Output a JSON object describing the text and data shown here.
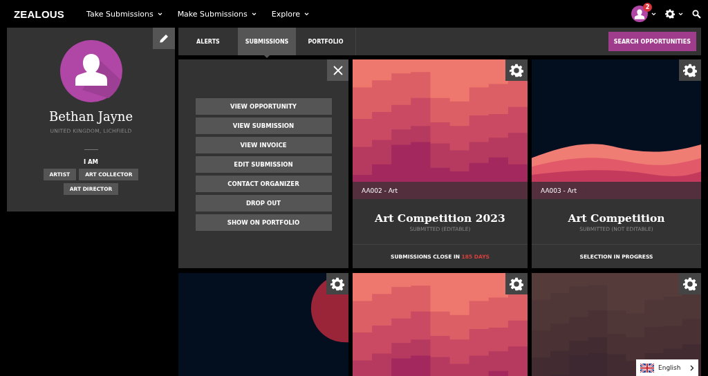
{
  "nav": {
    "logo": "ZEALOUS",
    "items": [
      {
        "label": "Take Submissions"
      },
      {
        "label": "Make Submissions"
      },
      {
        "label": "Explore"
      }
    ],
    "notification_count": "2"
  },
  "profile": {
    "name": "Bethan Jayne",
    "location": "UNITED KINGDOM, LICHFIELD",
    "roles_heading": "I AM",
    "roles": [
      "ARTIST",
      "ART COLLECTOR",
      "ART DIRECTOR"
    ]
  },
  "tabs": [
    {
      "label": "ALERTS",
      "selected": false
    },
    {
      "label": "SUBMISSIONS",
      "selected": true
    },
    {
      "label": "PORTFOLIO",
      "selected": false
    }
  ],
  "search_button": "SEARCH OPPORTUNITIES",
  "cards": [
    {
      "kind": "menu",
      "actions": [
        "VIEW OPPORTUNITY",
        "VIEW SUBMISSION",
        "VIEW INVOICE",
        "EDIT SUBMISSION",
        "CONTACT ORGANIZER",
        "DROP OUT",
        "SHOW ON PORTFOLIO"
      ]
    },
    {
      "kind": "submission",
      "code": "AA002 - Art",
      "title": "Art Competition 2023",
      "status": "SUBMITTED (EDITABLE)",
      "footer": "SUBMISSIONS CLOSE IN",
      "footer_highlight": "185 DAYS"
    },
    {
      "kind": "submission",
      "code": "AA003 - Art",
      "title": "Art Competition",
      "status": "SUBMITTED (NOT EDITABLE)",
      "footer": "SELECTION IN PROGRESS"
    },
    {
      "kind": "preview"
    },
    {
      "kind": "preview"
    },
    {
      "kind": "preview"
    }
  ],
  "language": {
    "label": "English"
  }
}
